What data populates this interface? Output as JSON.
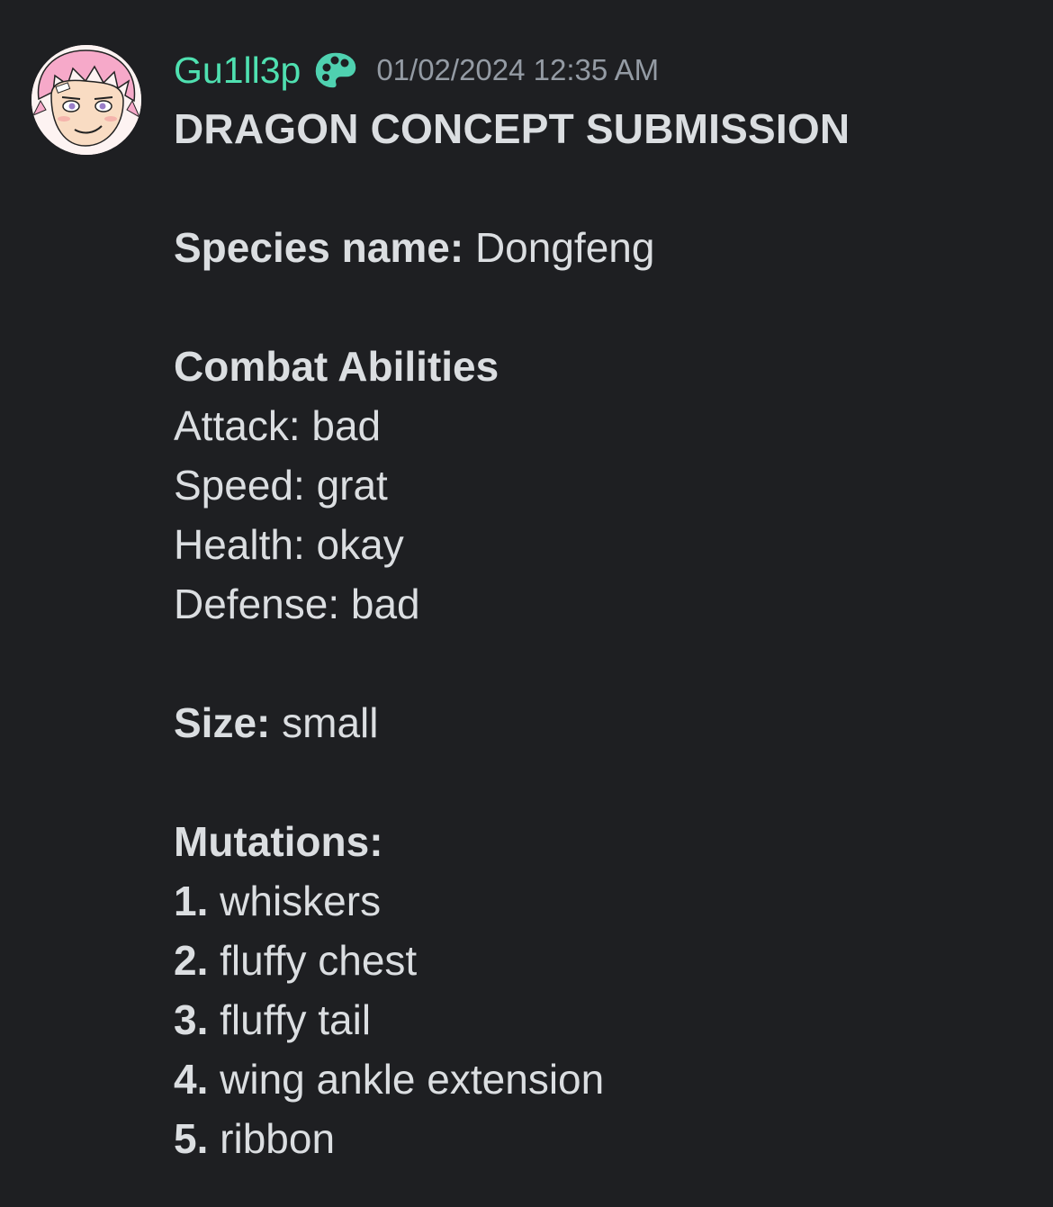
{
  "message": {
    "author": {
      "username": "Gu1ll3p",
      "name_color": "#4fe0b0",
      "role_icon": "palette-icon"
    },
    "timestamp": "01/02/2024 12:35 AM",
    "title": "DRAGON CONCEPT SUBMISSION",
    "species": {
      "label": "Species name:",
      "value": " Dongfeng"
    },
    "combat": {
      "heading": "Combat Abilities",
      "attack": "Attack: bad",
      "speed": "Speed: grat",
      "health": "Health: okay",
      "defense": "Defense: bad"
    },
    "size": {
      "label": "Size:",
      "value": " small"
    },
    "mutations": {
      "heading": "Mutations:",
      "items": [
        {
          "num": "1.",
          "text": " whiskers"
        },
        {
          "num": "2.",
          "text": " fluffy chest"
        },
        {
          "num": "3.",
          "text": " fluffy tail"
        },
        {
          "num": "4.",
          "text": " wing ankle extension"
        },
        {
          "num": "5.",
          "text": " ribbon"
        }
      ]
    }
  },
  "colors": {
    "background": "#1e1f22",
    "text": "#dbdee1",
    "muted": "#949ba4",
    "accent": "#4fe0b0"
  }
}
